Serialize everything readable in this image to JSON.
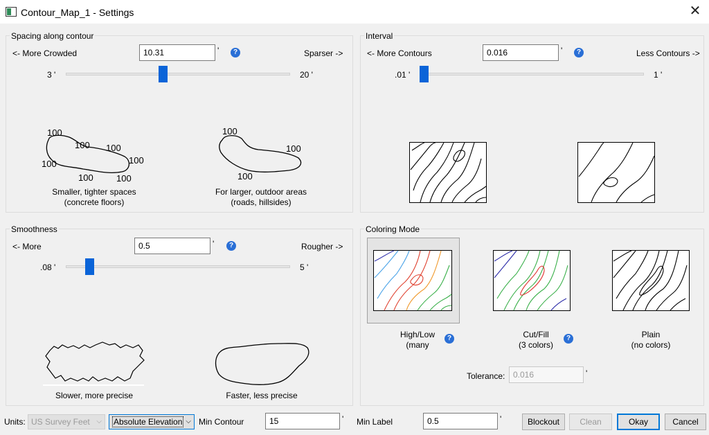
{
  "window": {
    "title": "Contour_Map_1 - Settings"
  },
  "spacing": {
    "title": "Spacing along contour",
    "left_label": "<- More Crowded",
    "right_label": "Sparser ->",
    "value": "10.31",
    "unit": "'",
    "min_label": "3 '",
    "max_label": "20 '",
    "slider_fraction": 0.43,
    "examples": [
      {
        "line1": "Smaller, tighter spaces",
        "line2": "(concrete floors)"
      },
      {
        "line1": "For larger, outdoor areas",
        "line2": "(roads, hillsides)"
      }
    ],
    "tight_labels": [
      "100",
      "100",
      "100",
      "100",
      "100",
      "100",
      "100"
    ],
    "loose_labels": [
      "100",
      "100",
      "100"
    ]
  },
  "interval": {
    "title": "Interval",
    "left_label": "<- More Contours",
    "right_label": "Less Contours ->",
    "value": "0.016",
    "unit": "'",
    "min_label": ".01 '",
    "max_label": "1 '",
    "slider_fraction": 0.0
  },
  "smoothness": {
    "title": "Smoothness",
    "left_label": "<- More",
    "right_label": "Rougher ->",
    "value": "0.5",
    "unit": "'",
    "min_label": ".08 '",
    "max_label": "5 '",
    "slider_fraction": 0.09,
    "examples": [
      {
        "line1": "Slower, more precise"
      },
      {
        "line1": "Faster, less precise"
      }
    ]
  },
  "coloring": {
    "title": "Coloring Mode",
    "modes": [
      {
        "line1": "High/Low",
        "line2": "(many",
        "selected": true
      },
      {
        "line1": "Cut/Fill",
        "line2": "(3 colors)",
        "selected": false
      },
      {
        "line1": "Plain",
        "line2": "(no colors)",
        "selected": false
      }
    ],
    "tolerance_label": "Tolerance:",
    "tolerance_value": "0.016",
    "tolerance_unit": "'"
  },
  "footer": {
    "units_label": "Units:",
    "units_value": "US Survey Feet",
    "elevation_value": "Absolute Elevation",
    "min_contour_label": "Min Contour",
    "min_contour_value": "15",
    "min_contour_unit": "'",
    "min_label_label": "Min Label",
    "min_label_value": "0.5",
    "min_label_unit": "'",
    "buttons": {
      "blockout": "Blockout",
      "clean": "Clean",
      "okay": "Okay",
      "cancel": "Cancel"
    }
  },
  "icons": {
    "help": "?",
    "close": "✕"
  },
  "colors": {
    "accent": "#0a64d8",
    "help": "#2a6fd6"
  }
}
